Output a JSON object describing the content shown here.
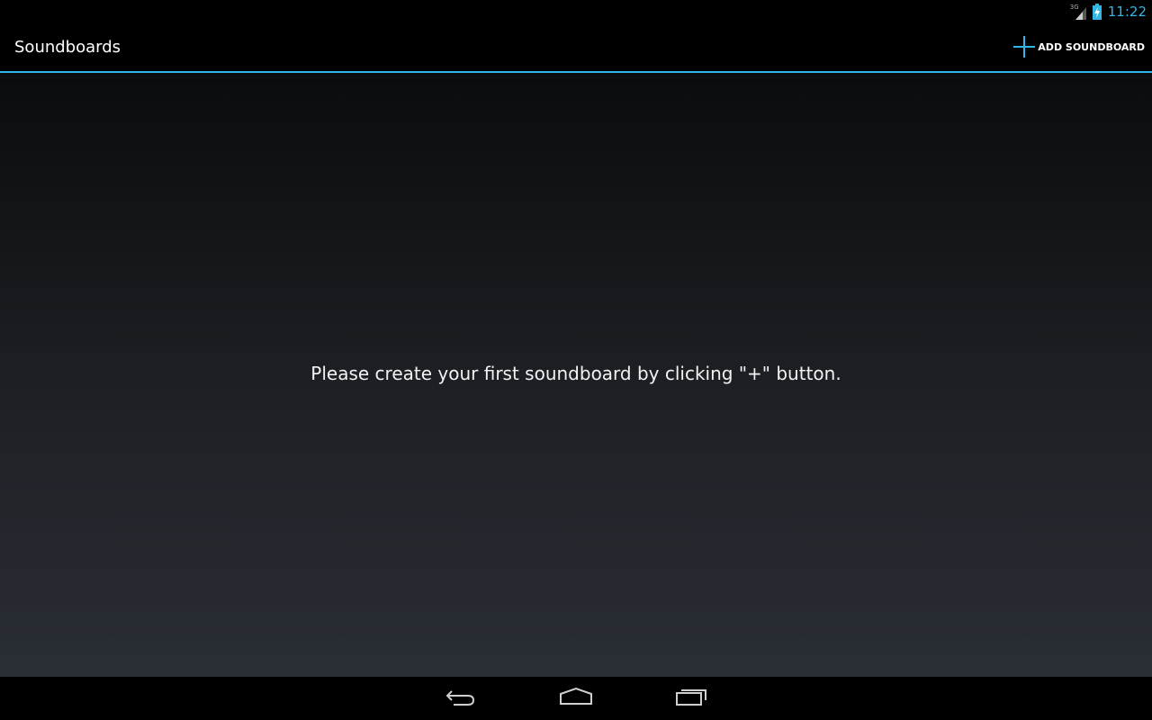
{
  "status_bar": {
    "network_label": "3G",
    "time": "11:22",
    "icons": [
      "signal-icon",
      "battery-charging-icon"
    ]
  },
  "action_bar": {
    "title": "Soundboards",
    "add_button_label": "ADD SOUNDBOARD",
    "add_button_icon": "plus-icon"
  },
  "main": {
    "empty_message": "Please create your first soundboard by clicking \"+\" button."
  },
  "nav_bar": {
    "buttons": [
      "back-icon",
      "home-icon",
      "recents-icon"
    ]
  },
  "colors": {
    "accent": "#33b5e5",
    "background_top": "#0a0c0e",
    "background_bottom": "#2a2e35",
    "bars": "#000000",
    "text": "#ffffff"
  }
}
